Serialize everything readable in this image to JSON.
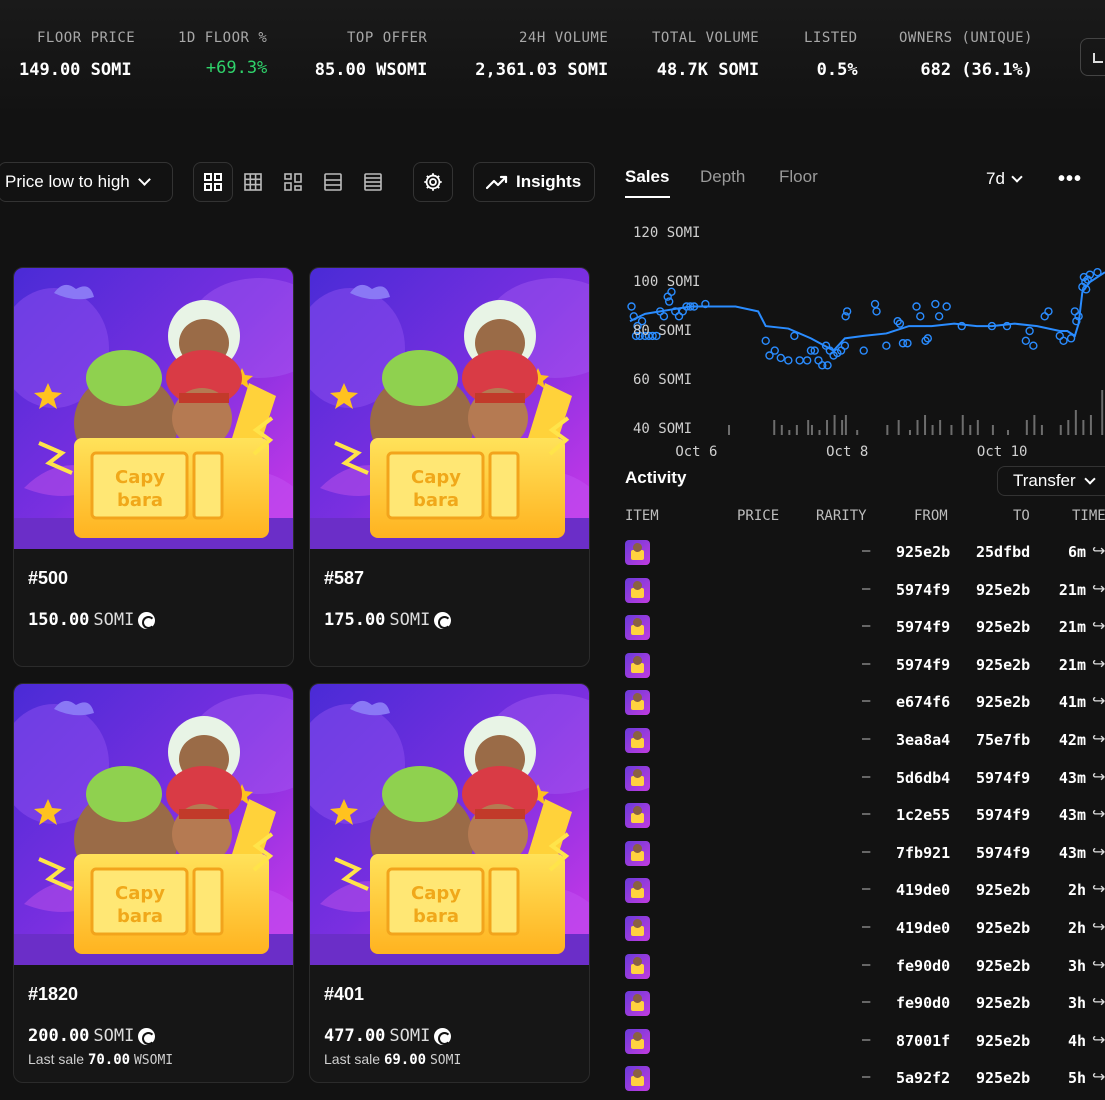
{
  "stats": [
    {
      "label": "FLOOR PRICE",
      "value": "149.00 SOMI"
    },
    {
      "label": "1D FLOOR %",
      "value": "+69.3%"
    },
    {
      "label": "TOP OFFER",
      "value": "85.00 WSOMI"
    },
    {
      "label": "24H VOLUME",
      "value": "2,361.03 SOMI"
    },
    {
      "label": "TOTAL VOLUME",
      "value": "48.7K SOMI"
    },
    {
      "label": "LISTED",
      "value": "0.5%"
    },
    {
      "label": "OWNERS (UNIQUE)",
      "value": "682 (36.1%)"
    }
  ],
  "toolbar": {
    "sort_label": "Price low to high",
    "insights_label": "Insights",
    "views": [
      "grid-large-icon",
      "grid-small-icon",
      "grid-mixed-icon",
      "list-icon",
      "list-dense-icon"
    ]
  },
  "cards": [
    {
      "name": "#500",
      "price": "150.00",
      "currency": "SOMI",
      "last_label": "",
      "last_price": "",
      "last_currency": ""
    },
    {
      "name": "#587",
      "price": "175.00",
      "currency": "SOMI",
      "last_label": "",
      "last_price": "",
      "last_currency": ""
    },
    {
      "name": "#1820",
      "price": "200.00",
      "currency": "SOMI",
      "last_label": "Last sale",
      "last_price": "70.00",
      "last_currency": "WSOMI"
    },
    {
      "name": "#401",
      "price": "477.00",
      "currency": "SOMI",
      "last_label": "Last sale",
      "last_price": "69.00",
      "last_currency": "SOMI"
    }
  ],
  "panel": {
    "tabs": [
      "Sales",
      "Depth",
      "Floor"
    ],
    "range": "7d",
    "more": "•••"
  },
  "chart_data": {
    "type": "scatter",
    "y_tick_labels": [
      "120 SOMI",
      "100 SOMI",
      "80 SOMI",
      "60 SOMI",
      "40 SOMI"
    ],
    "x_tick_labels": [
      "Oct 6",
      "Oct 8",
      "Oct 10"
    ],
    "ylim": [
      40,
      120
    ],
    "xlim": [
      5.2,
      11.5
    ],
    "scatter": [
      [
        5.22,
        90
      ],
      [
        5.25,
        86
      ],
      [
        5.28,
        78
      ],
      [
        5.3,
        82
      ],
      [
        5.33,
        78
      ],
      [
        5.36,
        84
      ],
      [
        5.4,
        78
      ],
      [
        5.45,
        78
      ],
      [
        5.5,
        78
      ],
      [
        5.55,
        78
      ],
      [
        5.6,
        88
      ],
      [
        5.65,
        86
      ],
      [
        5.7,
        94
      ],
      [
        5.72,
        92
      ],
      [
        5.75,
        96
      ],
      [
        5.8,
        88
      ],
      [
        5.85,
        86
      ],
      [
        5.9,
        88
      ],
      [
        5.95,
        90
      ],
      [
        6.0,
        90
      ],
      [
        6.05,
        90
      ],
      [
        6.2,
        91
      ],
      [
        7.0,
        76
      ],
      [
        7.05,
        70
      ],
      [
        7.12,
        72
      ],
      [
        7.2,
        69
      ],
      [
        7.3,
        68
      ],
      [
        7.38,
        78
      ],
      [
        7.45,
        68
      ],
      [
        7.55,
        68
      ],
      [
        7.6,
        72
      ],
      [
        7.65,
        72
      ],
      [
        7.7,
        68
      ],
      [
        7.75,
        66
      ],
      [
        7.8,
        74
      ],
      [
        7.82,
        66
      ],
      [
        7.85,
        72
      ],
      [
        7.9,
        70
      ],
      [
        7.95,
        71
      ],
      [
        8.0,
        72
      ],
      [
        8.05,
        74
      ],
      [
        8.06,
        86
      ],
      [
        8.08,
        88
      ],
      [
        8.3,
        72
      ],
      [
        8.45,
        91
      ],
      [
        8.47,
        88
      ],
      [
        8.6,
        74
      ],
      [
        8.75,
        84
      ],
      [
        8.78,
        83
      ],
      [
        8.82,
        75
      ],
      [
        8.88,
        75
      ],
      [
        9.0,
        90
      ],
      [
        9.05,
        86
      ],
      [
        9.12,
        76
      ],
      [
        9.15,
        77
      ],
      [
        9.25,
        91
      ],
      [
        9.3,
        86
      ],
      [
        9.4,
        90
      ],
      [
        9.6,
        82
      ],
      [
        10.0,
        82
      ],
      [
        10.2,
        82
      ],
      [
        10.45,
        76
      ],
      [
        10.5,
        80
      ],
      [
        10.55,
        74
      ],
      [
        10.7,
        86
      ],
      [
        10.75,
        88
      ],
      [
        10.9,
        78
      ],
      [
        10.95,
        76
      ],
      [
        11.05,
        77
      ],
      [
        11.1,
        88
      ],
      [
        11.12,
        84
      ],
      [
        11.15,
        86
      ],
      [
        11.2,
        98
      ],
      [
        11.22,
        102
      ],
      [
        11.24,
        100
      ],
      [
        11.25,
        97
      ],
      [
        11.27,
        101
      ],
      [
        11.3,
        103
      ],
      [
        11.4,
        104
      ]
    ],
    "floor_line": [
      [
        5.2,
        84
      ],
      [
        5.4,
        87
      ],
      [
        5.6,
        88
      ],
      [
        5.8,
        89
      ],
      [
        6.0,
        90
      ],
      [
        6.3,
        90
      ],
      [
        6.6,
        90
      ],
      [
        6.9,
        88
      ],
      [
        7.0,
        82
      ],
      [
        7.3,
        81
      ],
      [
        7.6,
        77
      ],
      [
        7.9,
        72
      ],
      [
        8.05,
        77
      ],
      [
        8.3,
        78
      ],
      [
        8.6,
        79
      ],
      [
        8.9,
        82
      ],
      [
        9.2,
        82
      ],
      [
        9.5,
        83
      ],
      [
        9.8,
        82
      ],
      [
        10.0,
        82
      ],
      [
        10.3,
        83
      ],
      [
        10.6,
        82
      ],
      [
        10.9,
        80
      ],
      [
        11.0,
        80
      ],
      [
        11.1,
        78
      ],
      [
        11.15,
        83
      ],
      [
        11.2,
        96
      ],
      [
        11.25,
        98
      ],
      [
        11.3,
        100
      ],
      [
        11.5,
        104
      ]
    ],
    "volume_bars": [
      [
        6.5,
        2
      ],
      [
        7.1,
        3
      ],
      [
        7.2,
        2
      ],
      [
        7.3,
        1
      ],
      [
        7.4,
        2
      ],
      [
        7.55,
        3
      ],
      [
        7.6,
        2
      ],
      [
        7.7,
        1
      ],
      [
        7.8,
        3
      ],
      [
        7.9,
        4
      ],
      [
        8.0,
        3
      ],
      [
        8.05,
        4
      ],
      [
        8.2,
        1
      ],
      [
        8.6,
        2
      ],
      [
        8.75,
        3
      ],
      [
        8.9,
        1
      ],
      [
        9.0,
        3
      ],
      [
        9.1,
        4
      ],
      [
        9.2,
        2
      ],
      [
        9.3,
        3
      ],
      [
        9.45,
        2
      ],
      [
        9.6,
        4
      ],
      [
        9.7,
        2
      ],
      [
        9.8,
        3
      ],
      [
        10.0,
        2
      ],
      [
        10.2,
        1
      ],
      [
        10.45,
        3
      ],
      [
        10.55,
        4
      ],
      [
        10.65,
        2
      ],
      [
        10.9,
        2
      ],
      [
        11.0,
        3
      ],
      [
        11.1,
        5
      ],
      [
        11.2,
        3
      ],
      [
        11.3,
        4
      ],
      [
        11.45,
        9
      ]
    ]
  },
  "activity": {
    "title": "Activity",
    "filter": "Transfer",
    "headers": [
      "ITEM",
      "PRICE",
      "RARITY",
      "FROM",
      "TO",
      "TIME"
    ],
    "rows": [
      {
        "rarity": "–",
        "from": "925e2b",
        "to": "25dfbd",
        "time": "6m"
      },
      {
        "rarity": "–",
        "from": "5974f9",
        "to": "925e2b",
        "time": "21m"
      },
      {
        "rarity": "–",
        "from": "5974f9",
        "to": "925e2b",
        "time": "21m"
      },
      {
        "rarity": "–",
        "from": "5974f9",
        "to": "925e2b",
        "time": "21m"
      },
      {
        "rarity": "–",
        "from": "e674f6",
        "to": "925e2b",
        "time": "41m"
      },
      {
        "rarity": "–",
        "from": "3ea8a4",
        "to": "75e7fb",
        "time": "42m"
      },
      {
        "rarity": "–",
        "from": "5d6db4",
        "to": "5974f9",
        "time": "43m"
      },
      {
        "rarity": "–",
        "from": "1c2e55",
        "to": "5974f9",
        "time": "43m"
      },
      {
        "rarity": "–",
        "from": "7fb921",
        "to": "5974f9",
        "time": "43m"
      },
      {
        "rarity": "–",
        "from": "419de0",
        "to": "925e2b",
        "time": "2h"
      },
      {
        "rarity": "–",
        "from": "419de0",
        "to": "925e2b",
        "time": "2h"
      },
      {
        "rarity": "–",
        "from": "fe90d0",
        "to": "925e2b",
        "time": "3h"
      },
      {
        "rarity": "–",
        "from": "fe90d0",
        "to": "925e2b",
        "time": "3h"
      },
      {
        "rarity": "–",
        "from": "87001f",
        "to": "925e2b",
        "time": "4h"
      },
      {
        "rarity": "–",
        "from": "5a92f2",
        "to": "925e2b",
        "time": "5h"
      }
    ]
  },
  "colors": {
    "accent": "#2a8cff",
    "positive": "#2fd36b",
    "background": "#121212"
  }
}
